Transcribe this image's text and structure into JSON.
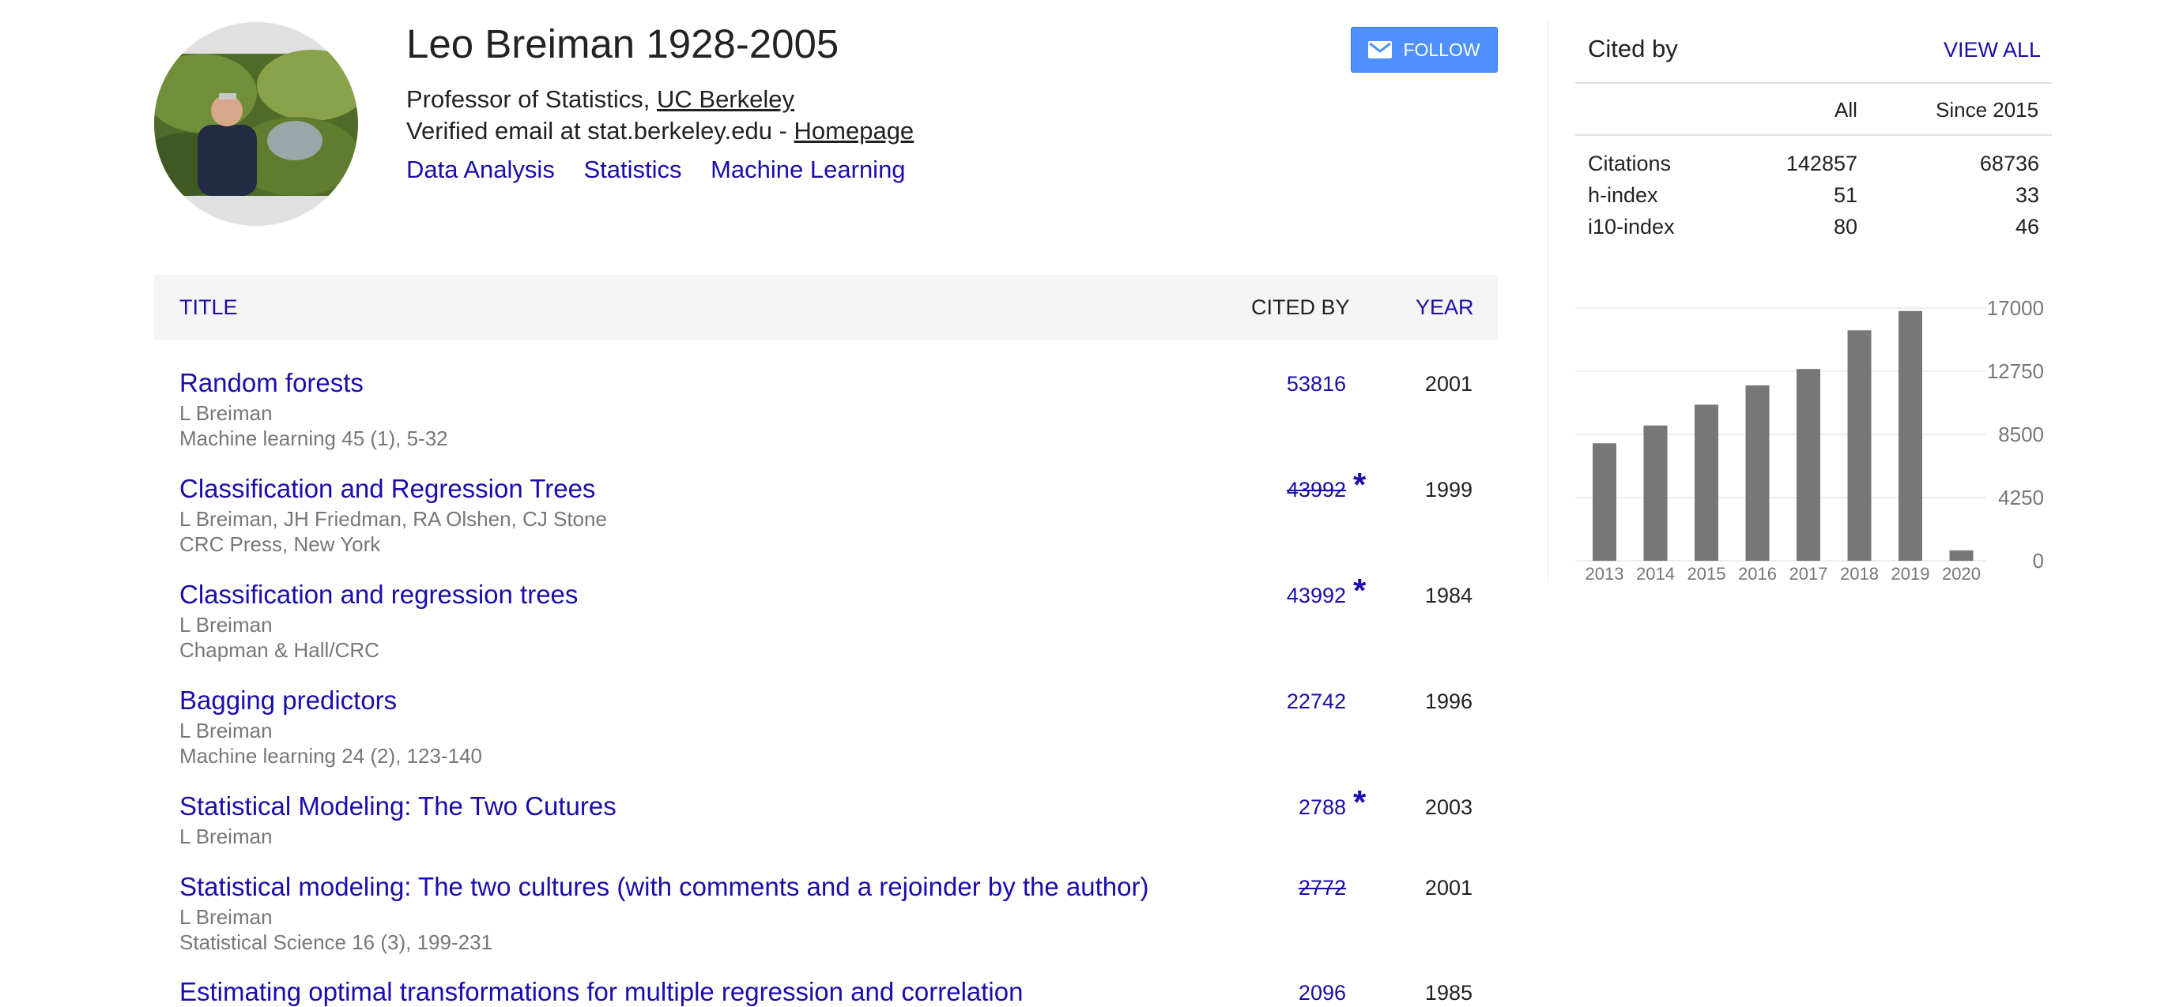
{
  "profile": {
    "name": "Leo Breiman 1928-2005",
    "affiliation_prefix": "Professor of Statistics, ",
    "affiliation_link": "UC Berkeley",
    "email_prefix": "Verified email at stat.berkeley.edu - ",
    "homepage_link": "Homepage",
    "interests": [
      "Data Analysis",
      "Statistics",
      "Machine Learning"
    ],
    "follow_label": "FOLLOW",
    "avatar_icon": "profile-photo"
  },
  "table": {
    "headers": {
      "title": "TITLE",
      "cited_by": "CITED BY",
      "year": "YEAR"
    },
    "rows": [
      {
        "title": "Random forests",
        "authors": "L Breiman",
        "venue": "Machine learning 45 (1), 5-32",
        "cited": "53816",
        "strike": false,
        "star": false,
        "year": "2001"
      },
      {
        "title": "Classification and Regression Trees",
        "authors": "L Breiman, JH Friedman, RA Olshen, CJ Stone",
        "venue": "CRC Press, New York",
        "cited": "43992",
        "strike": true,
        "star": true,
        "year": "1999"
      },
      {
        "title": "Classification and regression trees",
        "authors": "L Breiman",
        "venue": "Chapman & Hall/CRC",
        "cited": "43992",
        "strike": false,
        "star": true,
        "year": "1984"
      },
      {
        "title": "Bagging predictors",
        "authors": "L Breiman",
        "venue": "Machine learning 24 (2), 123-140",
        "cited": "22742",
        "strike": false,
        "star": false,
        "year": "1996"
      },
      {
        "title": "Statistical Modeling: The Two Cutures",
        "authors": "L Breiman",
        "venue": "",
        "cited": "2788",
        "strike": false,
        "star": true,
        "year": "2003"
      },
      {
        "title": "Statistical modeling: The two cultures (with comments and a rejoinder by the author)",
        "authors": "L Breiman",
        "venue": "Statistical Science 16 (3), 199-231",
        "cited": "2772",
        "strike": true,
        "star": false,
        "year": "2001"
      },
      {
        "title": "Estimating optimal transformations for multiple regression and correlation",
        "authors": "",
        "venue": "",
        "cited": "2096",
        "strike": false,
        "star": false,
        "year": "1985"
      }
    ],
    "star_glyph": "*"
  },
  "cited_by": {
    "title": "Cited by",
    "view_all": "VIEW ALL",
    "col_all": "All",
    "col_since": "Since 2015",
    "stats": [
      {
        "label": "Citations",
        "all": "142857",
        "since": "68736"
      },
      {
        "label": "h-index",
        "all": "51",
        "since": "33"
      },
      {
        "label": "i10-index",
        "all": "80",
        "since": "46"
      }
    ]
  },
  "chart_data": {
    "type": "bar",
    "categories": [
      "2013",
      "2014",
      "2015",
      "2016",
      "2017",
      "2018",
      "2019",
      "2020"
    ],
    "values": [
      7900,
      9100,
      10500,
      11800,
      12900,
      15500,
      16800,
      700
    ],
    "yticks": [
      "17000",
      "12750",
      "8500",
      "4250",
      "0"
    ],
    "ylim": [
      0,
      17000
    ],
    "bar_color": "#777777",
    "grid": true
  }
}
